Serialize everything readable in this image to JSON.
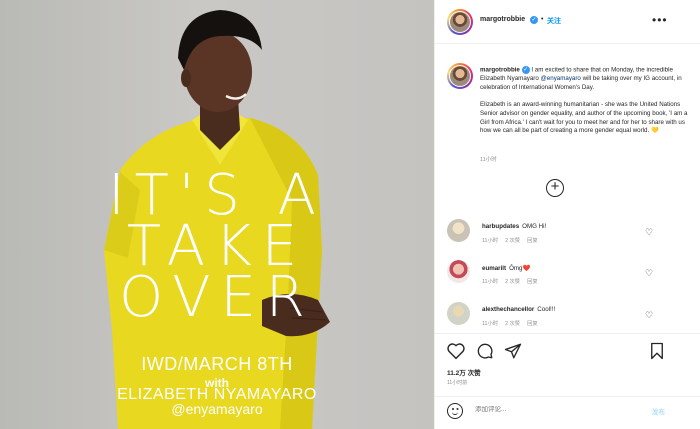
{
  "image": {
    "big_lines": [
      "IT'S A",
      "TAKE",
      "OVER"
    ],
    "date_line": "IWD/MARCH 8TH",
    "with_line": "with",
    "name_line": "ELIZABETH NYAMAYARO",
    "handle_line": "@enyamayaro"
  },
  "header": {
    "username": "margotrobbie",
    "separator": "•",
    "follow_label": "关注",
    "more_icon_glyph": "•••"
  },
  "caption": {
    "username": "margotrobbie",
    "para1_before": " I am excited to share that on Monday, the incredible Elizabeth Nyamayaro ",
    "mention": "@enyamayaro",
    "para1_after": " will be taking over my IG account, in celebration of International Women's Day.",
    "para2": "Elizabeth is an award-winning humanitarian - she was the United Nations Senior advisor on gender equality, and author of the upcoming book, 'I am a Girl from Africa.' I can't wait for you to meet her and for her to share with us how we can all be part of creating a more gender equal world. 💛",
    "time": "11小时"
  },
  "comments": [
    {
      "user": "harbupdates",
      "text": "OMG Hi!",
      "time": "11小时",
      "likes": "2 次赞",
      "reply": "回复"
    },
    {
      "user": "eumarilt",
      "text": "Ômg❤️",
      "time": "11小时",
      "likes": "2 次赞",
      "reply": "回复"
    },
    {
      "user": "alexthechancellor",
      "text": "Cool!!!",
      "time": "11小时",
      "likes": "2 次赞",
      "reply": "回复"
    }
  ],
  "actions": {
    "likes": "11.2万 次赞",
    "post_time": "11小时前"
  },
  "comment_bar": {
    "placeholder": "添加评论...",
    "post_label": "发布"
  },
  "colors": {
    "accent": "#0095f6",
    "verified": "#3897f0",
    "dress": "#e8d81f",
    "background": "#c6c5c2"
  }
}
